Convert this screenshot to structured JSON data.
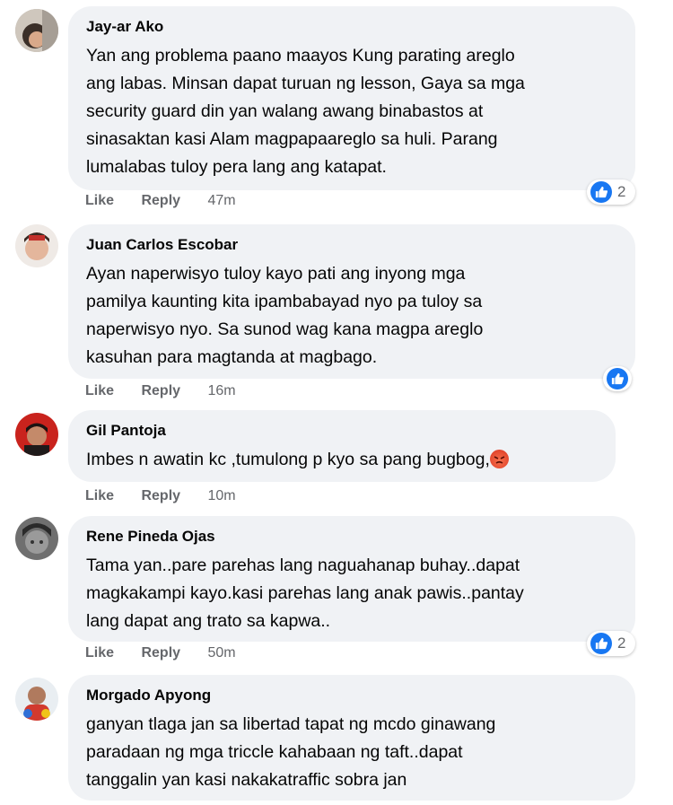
{
  "actions": {
    "like": "Like",
    "reply": "Reply"
  },
  "comments": [
    {
      "author": "Jay-ar Ako",
      "text": "Yan ang problema paano maayos Kung parating areglo\nang labas. Minsan dapat turuan ng lesson, Gaya sa mga\nsecurity guard din yan walang awang binabastos at\nsinasaktan kasi Alam magpapaareglo sa huli. Parang\nlumalabas tuloy pera lang ang katapat.",
      "time": "47m",
      "reactions": "2",
      "reaction_icon": "like-icon"
    },
    {
      "author": "Juan Carlos Escobar",
      "text": "Ayan naperwisyo tuloy kayo pati ang inyong mga\npamilya kaunting kita ipambabayad nyo pa tuloy sa\nnaperwisyo nyo. Sa sunod wag kana magpa areglo\nkasuhan para magtanda at magbago.",
      "time": "16m",
      "reaction_icon": "like-icon"
    },
    {
      "author": "Gil Pantoja",
      "text": "Imbes n awatin kc ,tumulong p kyo sa pang bugbog,",
      "time": "10m",
      "inline_emoji": "angry-face-icon"
    },
    {
      "author": "Rene Pineda Ojas",
      "text": "Tama yan..pare parehas lang naguahanap buhay..dapat\nmagkakampi kayo.kasi parehas lang anak pawis..pantay\nlang dapat ang trato sa kapwa..",
      "time": "50m",
      "reactions": "2",
      "reaction_icon": "like-icon"
    },
    {
      "author": "Morgado Apyong",
      "text": "ganyan tlaga jan sa libertad tapat ng mcdo ginawang\nparadaan ng mga triccle kahabaan ng taft..dapat\ntanggalin yan kasi nakakatraffic sobra jan"
    }
  ],
  "colors": {
    "bubble": "#f0f2f5",
    "meta": "#65676b",
    "like_blue": "#1877f2"
  }
}
